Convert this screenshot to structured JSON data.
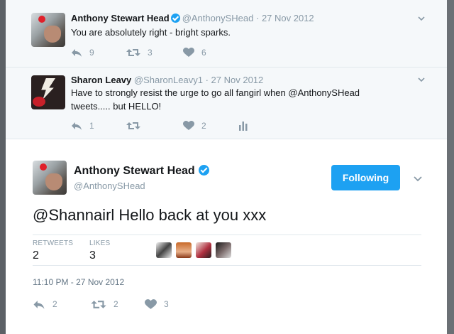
{
  "colors": {
    "accent": "#1da1f2",
    "secondary_text": "#8899a6",
    "conversation_bg": "#f5f8fa"
  },
  "conversation": [
    {
      "name": "Anthony Stewart Head",
      "verified": true,
      "handle": "@AnthonySHead",
      "separator": "·",
      "time": "27 Nov 2012",
      "text": "You are absolutely right - bright sparks.",
      "replies": "9",
      "retweets": "3",
      "likes": "6"
    },
    {
      "name": "Sharon Leavy",
      "verified": false,
      "handle": "@SharonLeavy1",
      "separator": "·",
      "time": "27 Nov 2012",
      "text": "Have to strongly resist the urge to go all fangirl when @AnthonySHead tweets..... but HELLO!",
      "replies": "1",
      "retweets": "",
      "likes": "2"
    }
  ],
  "main_tweet": {
    "name": "Anthony Stewart Head",
    "verified": true,
    "handle": "@AnthonySHead",
    "follow_label": "Following",
    "text": "@Shannairl Hello back at you xxx",
    "stats": {
      "retweets_label": "RETWEETS",
      "retweets_value": "2",
      "likes_label": "LIKES",
      "likes_value": "3"
    },
    "timestamp": "11:10 PM - 27 Nov 2012",
    "replies": "2",
    "retweets": "2",
    "likes": "3"
  },
  "icons": {
    "reply": "reply-icon",
    "retweet": "retweet-icon",
    "like": "heart-icon",
    "analytics": "analytics-icon",
    "more": "chevron-down-icon",
    "verified": "verified-badge-icon"
  }
}
